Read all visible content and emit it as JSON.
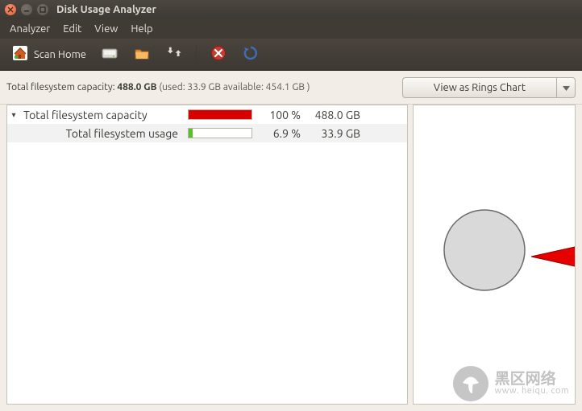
{
  "window": {
    "title": "Disk Usage Analyzer"
  },
  "menu": {
    "analyzer": "Analyzer",
    "edit": "Edit",
    "view": "View",
    "help": "Help"
  },
  "toolbar": {
    "scan_home_label": "Scan Home"
  },
  "info": {
    "label_prefix": "Total filesystem capacity: ",
    "capacity": "488.0 GB",
    "detail": " (used: 33.9 GB available: 454.1 GB )"
  },
  "view_selector": {
    "label": "View as Rings Chart"
  },
  "tree": {
    "rows": [
      {
        "label": "Total filesystem capacity",
        "pct": "100 %",
        "size": "488.0 GB",
        "bar_width": "100%",
        "bar_color": "#d70000",
        "indent": false,
        "expanded": true
      },
      {
        "label": "Total filesystem usage",
        "pct": "6.9 %",
        "size": "33.9 GB",
        "bar_width": "6.9%",
        "bar_color": "#5bbf2b",
        "indent": true,
        "expanded": false
      }
    ]
  },
  "chart_data": {
    "type": "pie",
    "title": "",
    "series": [
      {
        "name": "Available",
        "value": 454.1,
        "color": "#d9d9d9"
      },
      {
        "name": "Used",
        "value": 33.9,
        "color": "#e60000"
      }
    ],
    "total": 488.0,
    "unit": "GB"
  },
  "watermark": {
    "line1": "黑区网络",
    "line2": "www. heiqu. com"
  }
}
